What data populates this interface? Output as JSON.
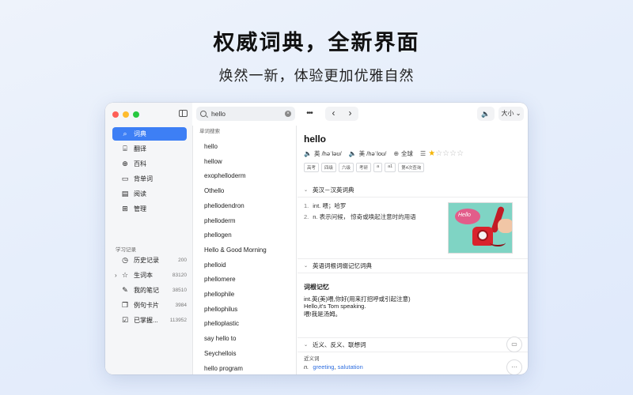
{
  "headline": "权威词典，全新界面",
  "subheadline": "焕然一新，体验更加优雅自然",
  "toolbar": {
    "search_value": "hello",
    "more_label": "•••",
    "back_label": "‹",
    "forward_label": "›",
    "speaker_label": "🔈",
    "size_label": "大小 ⌄"
  },
  "sidebar": {
    "items": [
      {
        "label": "词典",
        "icon": "search-icon",
        "glyph": "⌕",
        "active": true
      },
      {
        "label": "翻译",
        "icon": "translate-icon",
        "glyph": "⌸"
      },
      {
        "label": "百科",
        "icon": "globe-icon",
        "glyph": "⊕"
      },
      {
        "label": "背单词",
        "icon": "flashcard-icon",
        "glyph": "▭"
      },
      {
        "label": "阅读",
        "icon": "book-icon",
        "glyph": "▤"
      },
      {
        "label": "管理",
        "icon": "grid-icon",
        "glyph": "⊞"
      }
    ],
    "records_title": "学习记录",
    "records": [
      {
        "label": "历史记录",
        "count": "200",
        "icon": "history-icon",
        "glyph": "◷"
      },
      {
        "label": "生词本",
        "count": "83120",
        "icon": "star-icon",
        "glyph": "☆"
      },
      {
        "label": "我的笔记",
        "count": "38510",
        "icon": "pencil-icon",
        "glyph": "✎"
      },
      {
        "label": "例句卡片",
        "count": "3984",
        "icon": "cards-icon",
        "glyph": "❐"
      },
      {
        "label": "已掌握...",
        "count": "113952",
        "icon": "calendar-check-icon",
        "glyph": "☑"
      }
    ]
  },
  "wordlist": {
    "header": "单词搜索",
    "items": [
      "hello",
      "hellow",
      "exophelloderm",
      "Othello",
      "phellodendron",
      "phelloderm",
      "phellogen",
      "Hello & Good Morning",
      "phelloid",
      "phellomere",
      "phellophile",
      "phellophilus",
      "phelloplastic",
      "say hello to",
      "Seychellois",
      "hello program"
    ]
  },
  "detail": {
    "word": "hello",
    "uk_label": "英",
    "uk_phonetic": "/həˈləʊ/",
    "us_label": "美",
    "us_phonetic": "/həˈloʊ/",
    "global_label": "全球",
    "star_rating": 1,
    "star_max": 5,
    "tags": [
      "高考",
      "四级",
      "六级",
      "考研",
      "a",
      "a1",
      "第4次查询"
    ],
    "section1_title": "英汉－汉英词典",
    "definitions": [
      {
        "num": "1.",
        "text": "int. 喂；哈罗"
      },
      {
        "num": "2.",
        "text": "n. 表示问候， 惊奇或唤起注意时的用语"
      }
    ],
    "image_text": "Hello",
    "section2_title": "英语词根词缀记忆词典",
    "etymology_title": "词根记忆",
    "etymology_lines": [
      "int.英(美)喂,你好(用来打招呼或引起注意)",
      "Hello,it's Tom speaking.",
      "喂!我是汤姆。"
    ],
    "section3_title": "近义、反义、联想词",
    "synonym_label": "近义词",
    "synonym_pos": "n.",
    "synonyms": [
      "greeting",
      "salutation"
    ],
    "synonym_sep": ", "
  },
  "colors": {
    "accent": "#3d7ff5",
    "link": "#2f6fe0",
    "star": "#f5b400"
  }
}
